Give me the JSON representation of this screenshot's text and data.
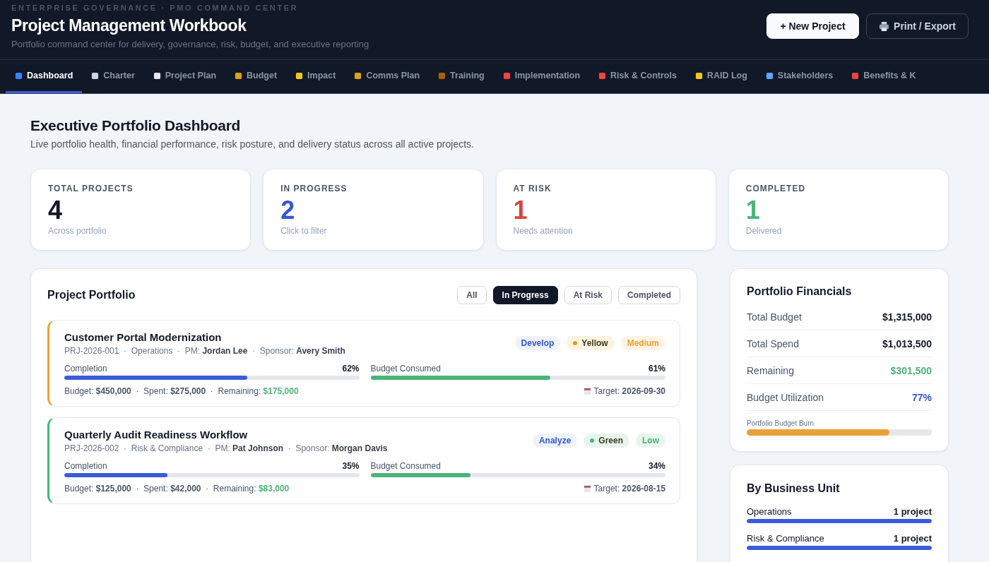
{
  "header": {
    "eyebrow": "ENTERPRISE GOVERNANCE · PMO COMMAND CENTER",
    "title": "Project Management Workbook",
    "subtitle": "Portfolio command center for delivery, governance, risk, budget, and executive reporting",
    "buttons": [
      {
        "label": "+ New Project",
        "kind": "primary"
      },
      {
        "label": "Print / Export",
        "kind": "print"
      }
    ]
  },
  "tabs": [
    {
      "label": "Dashboard",
      "selected": true
    },
    {
      "label": "Charter",
      "selected": false
    },
    {
      "label": "Project Plan",
      "selected": false
    },
    {
      "label": "Budget",
      "selected": false
    },
    {
      "label": "Impact",
      "selected": false
    },
    {
      "label": "Comms Plan",
      "selected": false
    },
    {
      "label": "Training",
      "selected": false
    },
    {
      "label": "Implementation",
      "selected": false
    },
    {
      "label": "Risk & Controls",
      "selected": false
    },
    {
      "label": "RAID Log",
      "selected": false
    },
    {
      "label": "Stakeholders",
      "selected": false
    },
    {
      "label": "Benefits & K",
      "selected": false
    }
  ],
  "page": {
    "title": "Executive Portfolio Dashboard",
    "subtitle": "Live portfolio health, financial performance, risk posture, and delivery status across all active projects."
  },
  "stats": [
    {
      "label": "TOTAL PROJECTS",
      "value": "4",
      "note": "Across portfolio",
      "color": "#111827"
    },
    {
      "label": "IN PROGRESS",
      "value": "2",
      "note": "Click to filter",
      "color": "#3358d4"
    },
    {
      "label": "AT RISK",
      "value": "1",
      "note": "Needs attention",
      "color": "#d64541"
    },
    {
      "label": "COMPLETED",
      "value": "1",
      "note": "Delivered",
      "color": "#4cb37a"
    }
  ],
  "portfolio": {
    "title": "Project Portfolio",
    "filters": [
      {
        "label": "All",
        "selected": false
      },
      {
        "label": "In Progress",
        "selected": true
      },
      {
        "label": "At Risk",
        "selected": false
      },
      {
        "label": "Completed",
        "selected": false
      }
    ],
    "projects": [
      {
        "name": "Customer Portal Modernization",
        "color": "#e8a23a",
        "meta": "PRJ-2026-001  ·  Operations  ·  PM: **Jordan Lee**  ·  Sponsor: **Avery Smith**",
        "phase": "Develop",
        "status": {
          "label": "Yellow",
          "color": "#d9a21b"
        },
        "risk": {
          "label": "Medium",
          "color": "#e8a23a"
        },
        "completion_label": "Completion",
        "completion": {
          "reading": "62%",
          "level": 0.62
        },
        "budget_label": "Budget Consumed",
        "budget": {
          "reading": "61%",
          "level": 0.61
        },
        "money": "Budget: **$450,000**  ·  Spent: **$275,000**  ·  Remaining: ",
        "remaining": "$175,000",
        "target": "Target: **2026-09-30**"
      },
      {
        "name": "Quarterly Audit Readiness Workflow",
        "color": "#4cb37a",
        "meta": "PRJ-2026-002  ·  Risk & Compliance  ·  PM: **Pat Johnson**  ·  Sponsor: **Morgan Davis**",
        "phase": "Analyze",
        "status": {
          "label": "Green",
          "color": "#4cb37a"
        },
        "risk": {
          "label": "Low",
          "color": "#4cb37a"
        },
        "completion_label": "Completion",
        "completion": {
          "reading": "35%",
          "level": 0.35
        },
        "budget_label": "Budget Consumed",
        "budget": {
          "reading": "34%",
          "level": 0.34
        },
        "money": "Budget: **$125,000**  ·  Spent: **$42,000**  ·  Remaining: ",
        "remaining": "$83,000",
        "target": "Target: **2026-08-15**"
      }
    ]
  },
  "financials": {
    "title": "Portfolio Financials",
    "rows": [
      {
        "label": "Total Budget",
        "value": "$1,315,000",
        "kind": "plain"
      },
      {
        "label": "Total Spend",
        "value": "$1,013,500",
        "kind": "plain"
      },
      {
        "label": "Remaining",
        "value": "$301,500",
        "kind": "good"
      },
      {
        "label": "Budget Utilization",
        "value": "77%",
        "kind": "accent"
      }
    ],
    "burn": {
      "label": "Portfolio Budget Burn",
      "level": 0.77
    }
  },
  "units": {
    "title": "By Business Unit",
    "rows": [
      {
        "label": "Operations",
        "count": "1 project",
        "level": 1
      },
      {
        "label": "Risk & Compliance",
        "count": "1 project",
        "level": 1
      }
    ]
  }
}
